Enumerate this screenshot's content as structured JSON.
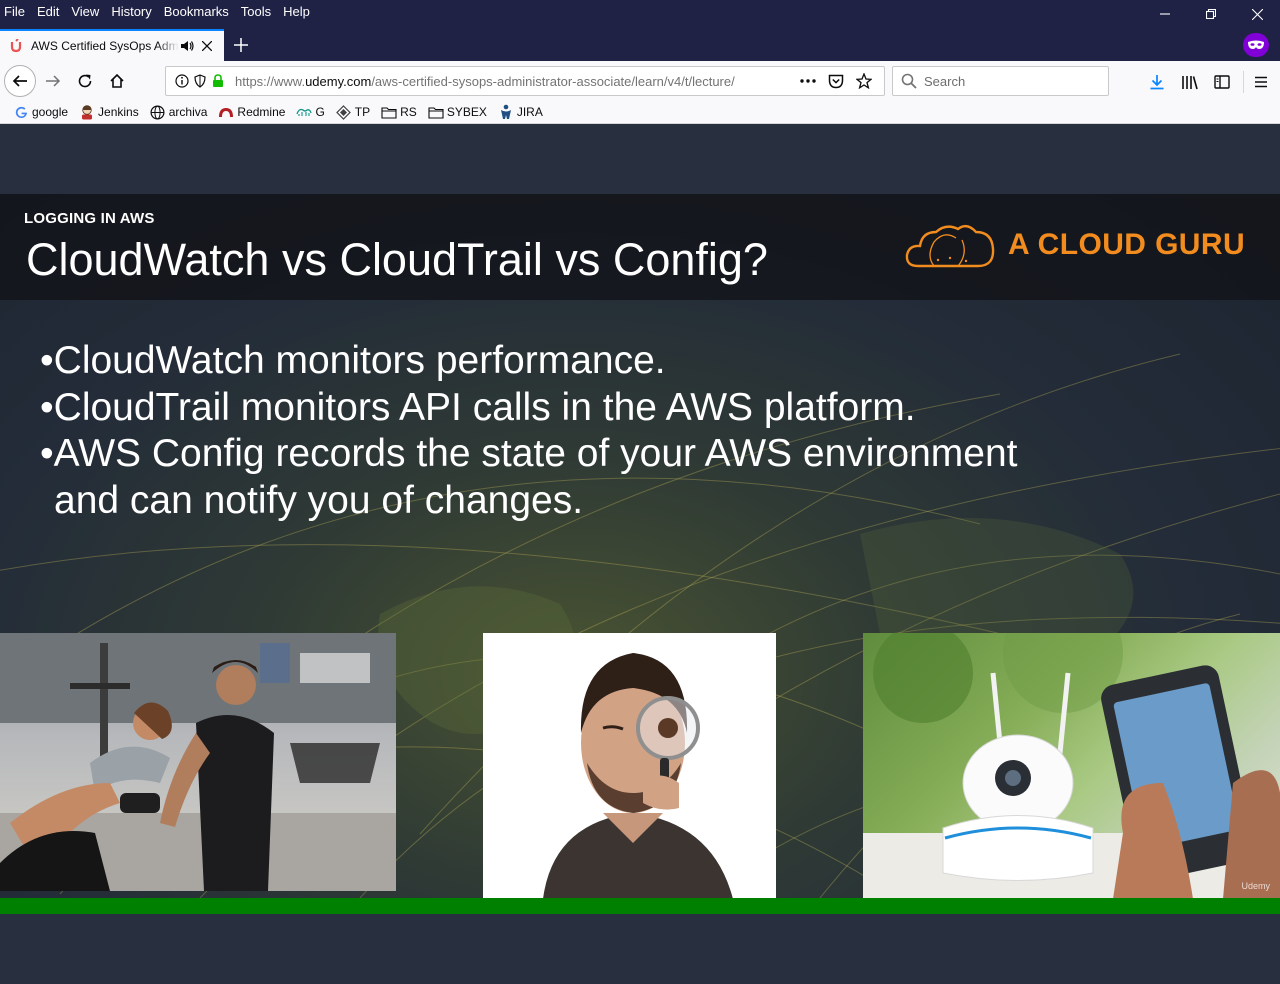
{
  "menu": [
    "File",
    "Edit",
    "View",
    "History",
    "Bookmarks",
    "Tools",
    "Help"
  ],
  "tab": {
    "title": "AWS Certified SysOps Administrator - Associate | Udemy"
  },
  "url": {
    "prefix": "https://www.",
    "domain": "udemy.com",
    "path": "/aws-certified-sysops-administrator-associate/learn/v4/t/lecture/"
  },
  "search": {
    "placeholder": "Search"
  },
  "bookmarks": [
    "google",
    "Jenkins",
    "archiva",
    "Redmine",
    "G",
    "TP",
    "RS",
    "SYBEX",
    "JIRA"
  ],
  "slide": {
    "kicker": "LOGGING IN AWS",
    "title": "CloudWatch vs CloudTrail vs Config?",
    "brand": "A CLOUD GURU",
    "bullets": [
      "•CloudWatch monitors performance.",
      "•CloudTrail monitors API calls in the AWS platform.",
      "•AWS Config records the state of your AWS environment"
    ],
    "bullet_continuation": "and can notify you of changes.",
    "watermark": "Udemy"
  },
  "colors": {
    "brand_orange": "#f28c1e",
    "progress_green": "#008000",
    "chrome_dark": "#1f2245"
  }
}
